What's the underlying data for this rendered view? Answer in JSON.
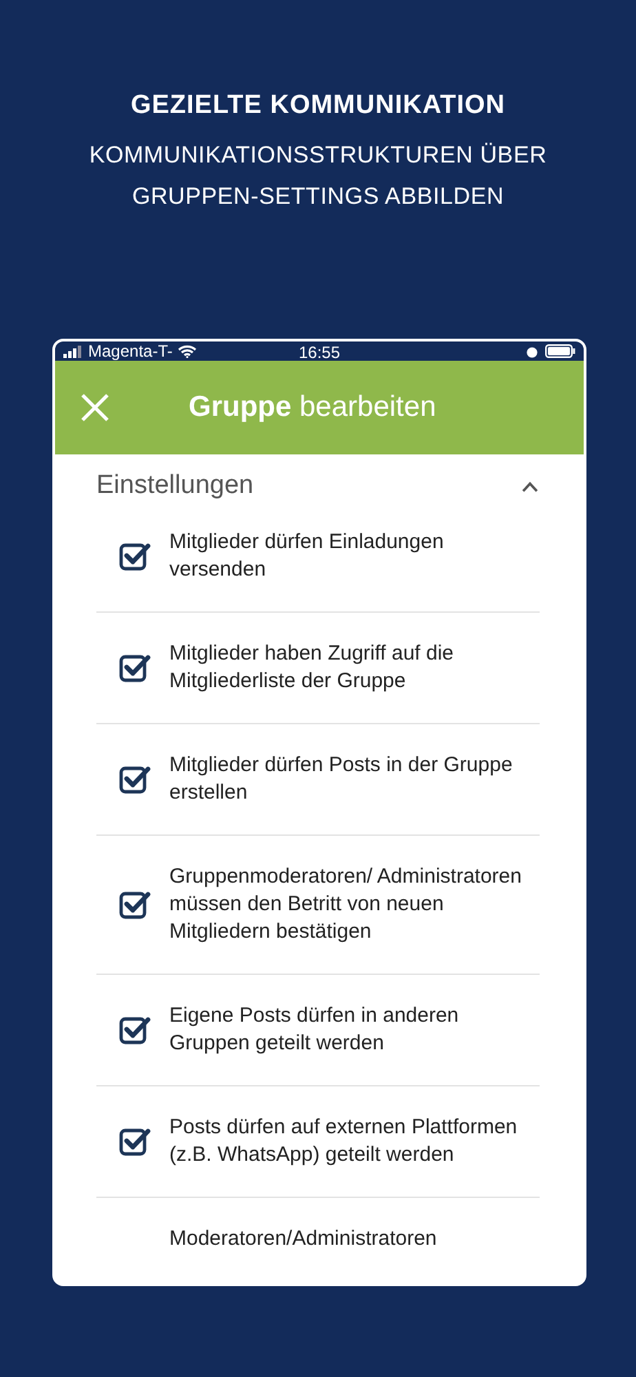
{
  "headline": {
    "title": "GEZIELTE KOMMUNIKATION",
    "subtitle": "KOMMUNIKATIONSSTRUKTUREN ÜBER GRUPPEN-SETTINGS ABBILDEN"
  },
  "status_bar": {
    "carrier": "Magenta-T-",
    "time": "16:55"
  },
  "header": {
    "title": "**Gruppe** bearbeiten"
  },
  "section": {
    "title": "Einstellungen",
    "expanded": true
  },
  "settings": [
    {
      "label": "Mitglieder dürfen Einladungen versenden",
      "checked": true
    },
    {
      "label": "Mitglieder haben Zugriff auf die Mitgliederliste der Gruppe",
      "checked": true
    },
    {
      "label": "Mitglieder dürfen Posts in der Gruppe erstellen",
      "checked": true
    },
    {
      "label": "Gruppenmoderatoren/ Administratoren müssen den Betritt von neuen Mitgliedern bestätigen",
      "checked": true
    },
    {
      "label": "Eigene Posts dürfen in anderen Gruppen geteilt werden",
      "checked": true
    },
    {
      "label": "Posts dürfen auf externen Plattformen (z.B. WhatsApp) geteilt werden",
      "checked": true
    }
  ],
  "cut_off_setting": {
    "label": "Moderatoren/Administratoren"
  }
}
